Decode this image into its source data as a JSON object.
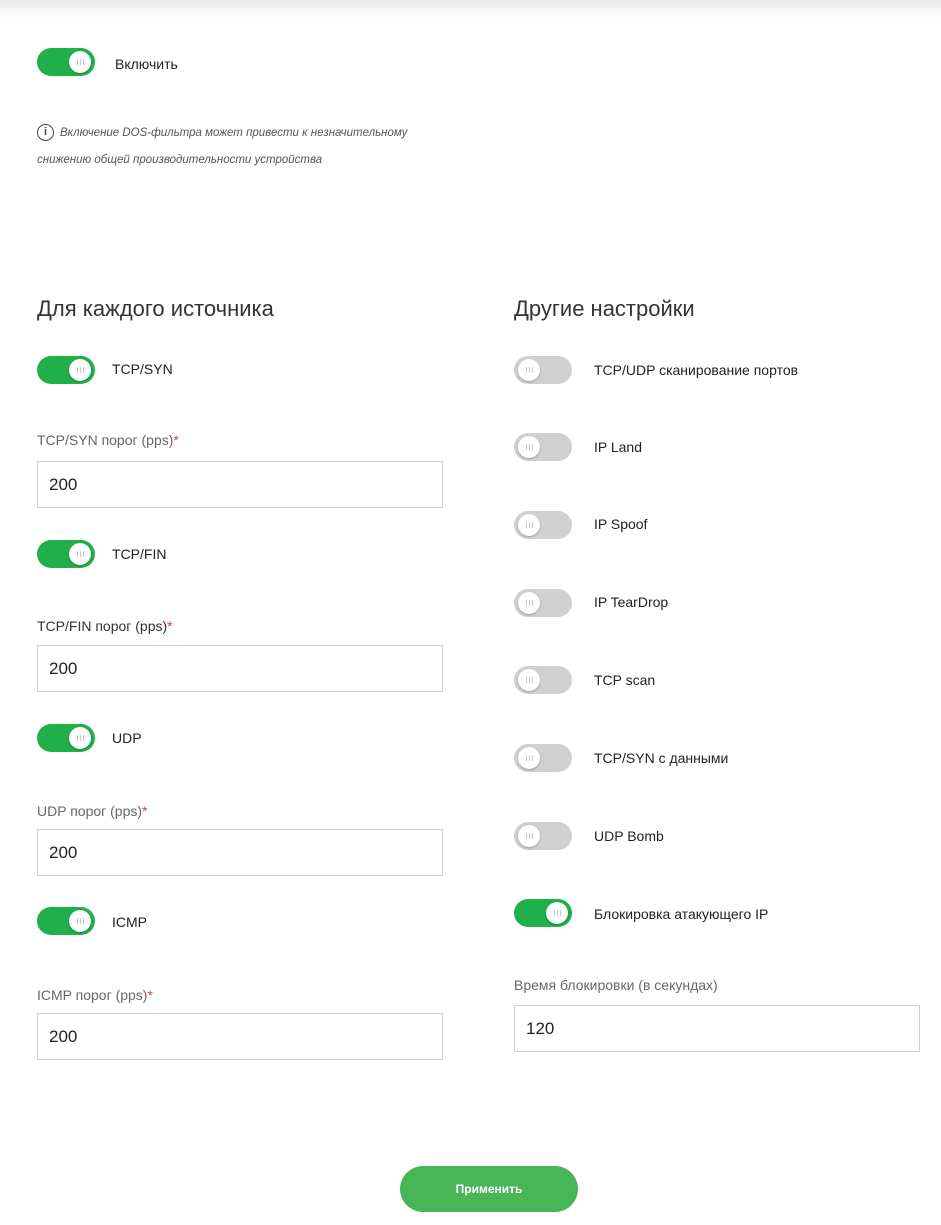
{
  "enable": {
    "label": "Включить",
    "on": true,
    "info_icon": "info-icon",
    "info_text": "Включение DOS-фильтра может привести к незначительному снижению общей производительности устройства"
  },
  "left": {
    "title": "Для каждого источника",
    "items": [
      {
        "label": "TCP/SYN",
        "on": true,
        "field_label": "TCP/SYN порог (pps)",
        "required": "*",
        "value": "200"
      },
      {
        "label": "TCP/FIN",
        "on": true,
        "field_label": "TCP/FIN порог (pps)",
        "required": "*",
        "value": "200"
      },
      {
        "label": "UDP",
        "on": true,
        "field_label": "UDP порог (pps)",
        "required": "*",
        "value": "200"
      },
      {
        "label": "ICMP",
        "on": true,
        "field_label": "ICMP порог (pps)",
        "required": "*",
        "value": "200"
      }
    ]
  },
  "right": {
    "title": "Другие настройки",
    "items": [
      {
        "label": "TCP/UDP сканирование портов",
        "on": false
      },
      {
        "label": "IP Land",
        "on": false
      },
      {
        "label": "IP Spoof",
        "on": false
      },
      {
        "label": "IP TearDrop",
        "on": false
      },
      {
        "label": "TCP scan",
        "on": false
      },
      {
        "label": "TCP/SYN с данными",
        "on": false
      },
      {
        "label": "UDP Bomb",
        "on": false
      },
      {
        "label": "Блокировка атакующего IP",
        "on": true
      }
    ],
    "block_time": {
      "label": "Время блокировки (в секундах)",
      "value": "120"
    }
  },
  "apply_label": "Применить",
  "colors": {
    "toggle_on": "#20b04a",
    "toggle_off": "#d0d0d0",
    "apply_button": "#48b657",
    "required": "#e53935"
  }
}
